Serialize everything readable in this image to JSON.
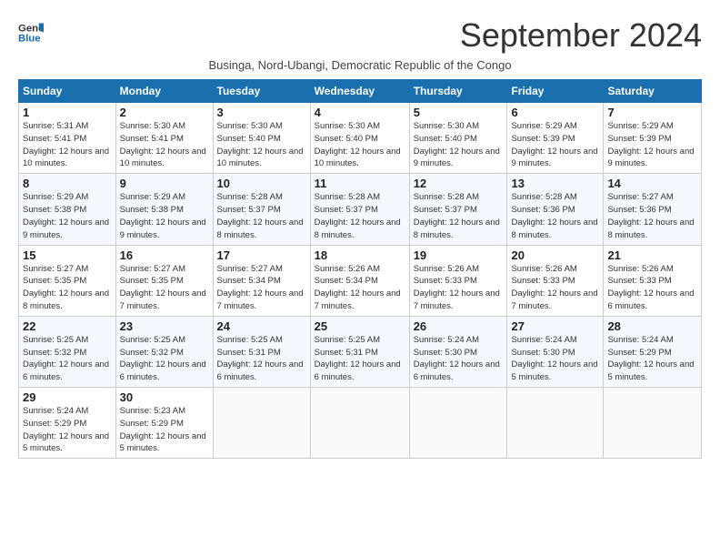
{
  "logo": {
    "line1": "General",
    "line2": "Blue"
  },
  "title": "September 2024",
  "subtitle": "Businga, Nord-Ubangi, Democratic Republic of the Congo",
  "days_of_week": [
    "Sunday",
    "Monday",
    "Tuesday",
    "Wednesday",
    "Thursday",
    "Friday",
    "Saturday"
  ],
  "weeks": [
    [
      {
        "day": 1,
        "sunrise": "5:31 AM",
        "sunset": "5:41 PM",
        "daylight": "12 hours and 10 minutes."
      },
      {
        "day": 2,
        "sunrise": "5:30 AM",
        "sunset": "5:41 PM",
        "daylight": "12 hours and 10 minutes."
      },
      {
        "day": 3,
        "sunrise": "5:30 AM",
        "sunset": "5:40 PM",
        "daylight": "12 hours and 10 minutes."
      },
      {
        "day": 4,
        "sunrise": "5:30 AM",
        "sunset": "5:40 PM",
        "daylight": "12 hours and 10 minutes."
      },
      {
        "day": 5,
        "sunrise": "5:30 AM",
        "sunset": "5:40 PM",
        "daylight": "12 hours and 9 minutes."
      },
      {
        "day": 6,
        "sunrise": "5:29 AM",
        "sunset": "5:39 PM",
        "daylight": "12 hours and 9 minutes."
      },
      {
        "day": 7,
        "sunrise": "5:29 AM",
        "sunset": "5:39 PM",
        "daylight": "12 hours and 9 minutes."
      }
    ],
    [
      {
        "day": 8,
        "sunrise": "5:29 AM",
        "sunset": "5:38 PM",
        "daylight": "12 hours and 9 minutes."
      },
      {
        "day": 9,
        "sunrise": "5:29 AM",
        "sunset": "5:38 PM",
        "daylight": "12 hours and 9 minutes."
      },
      {
        "day": 10,
        "sunrise": "5:28 AM",
        "sunset": "5:37 PM",
        "daylight": "12 hours and 8 minutes."
      },
      {
        "day": 11,
        "sunrise": "5:28 AM",
        "sunset": "5:37 PM",
        "daylight": "12 hours and 8 minutes."
      },
      {
        "day": 12,
        "sunrise": "5:28 AM",
        "sunset": "5:37 PM",
        "daylight": "12 hours and 8 minutes."
      },
      {
        "day": 13,
        "sunrise": "5:28 AM",
        "sunset": "5:36 PM",
        "daylight": "12 hours and 8 minutes."
      },
      {
        "day": 14,
        "sunrise": "5:27 AM",
        "sunset": "5:36 PM",
        "daylight": "12 hours and 8 minutes."
      }
    ],
    [
      {
        "day": 15,
        "sunrise": "5:27 AM",
        "sunset": "5:35 PM",
        "daylight": "12 hours and 8 minutes."
      },
      {
        "day": 16,
        "sunrise": "5:27 AM",
        "sunset": "5:35 PM",
        "daylight": "12 hours and 7 minutes."
      },
      {
        "day": 17,
        "sunrise": "5:27 AM",
        "sunset": "5:34 PM",
        "daylight": "12 hours and 7 minutes."
      },
      {
        "day": 18,
        "sunrise": "5:26 AM",
        "sunset": "5:34 PM",
        "daylight": "12 hours and 7 minutes."
      },
      {
        "day": 19,
        "sunrise": "5:26 AM",
        "sunset": "5:33 PM",
        "daylight": "12 hours and 7 minutes."
      },
      {
        "day": 20,
        "sunrise": "5:26 AM",
        "sunset": "5:33 PM",
        "daylight": "12 hours and 7 minutes."
      },
      {
        "day": 21,
        "sunrise": "5:26 AM",
        "sunset": "5:33 PM",
        "daylight": "12 hours and 6 minutes."
      }
    ],
    [
      {
        "day": 22,
        "sunrise": "5:25 AM",
        "sunset": "5:32 PM",
        "daylight": "12 hours and 6 minutes."
      },
      {
        "day": 23,
        "sunrise": "5:25 AM",
        "sunset": "5:32 PM",
        "daylight": "12 hours and 6 minutes."
      },
      {
        "day": 24,
        "sunrise": "5:25 AM",
        "sunset": "5:31 PM",
        "daylight": "12 hours and 6 minutes."
      },
      {
        "day": 25,
        "sunrise": "5:25 AM",
        "sunset": "5:31 PM",
        "daylight": "12 hours and 6 minutes."
      },
      {
        "day": 26,
        "sunrise": "5:24 AM",
        "sunset": "5:30 PM",
        "daylight": "12 hours and 6 minutes."
      },
      {
        "day": 27,
        "sunrise": "5:24 AM",
        "sunset": "5:30 PM",
        "daylight": "12 hours and 5 minutes."
      },
      {
        "day": 28,
        "sunrise": "5:24 AM",
        "sunset": "5:29 PM",
        "daylight": "12 hours and 5 minutes."
      }
    ],
    [
      {
        "day": 29,
        "sunrise": "5:24 AM",
        "sunset": "5:29 PM",
        "daylight": "12 hours and 5 minutes."
      },
      {
        "day": 30,
        "sunrise": "5:23 AM",
        "sunset": "5:29 PM",
        "daylight": "12 hours and 5 minutes."
      },
      null,
      null,
      null,
      null,
      null
    ]
  ]
}
